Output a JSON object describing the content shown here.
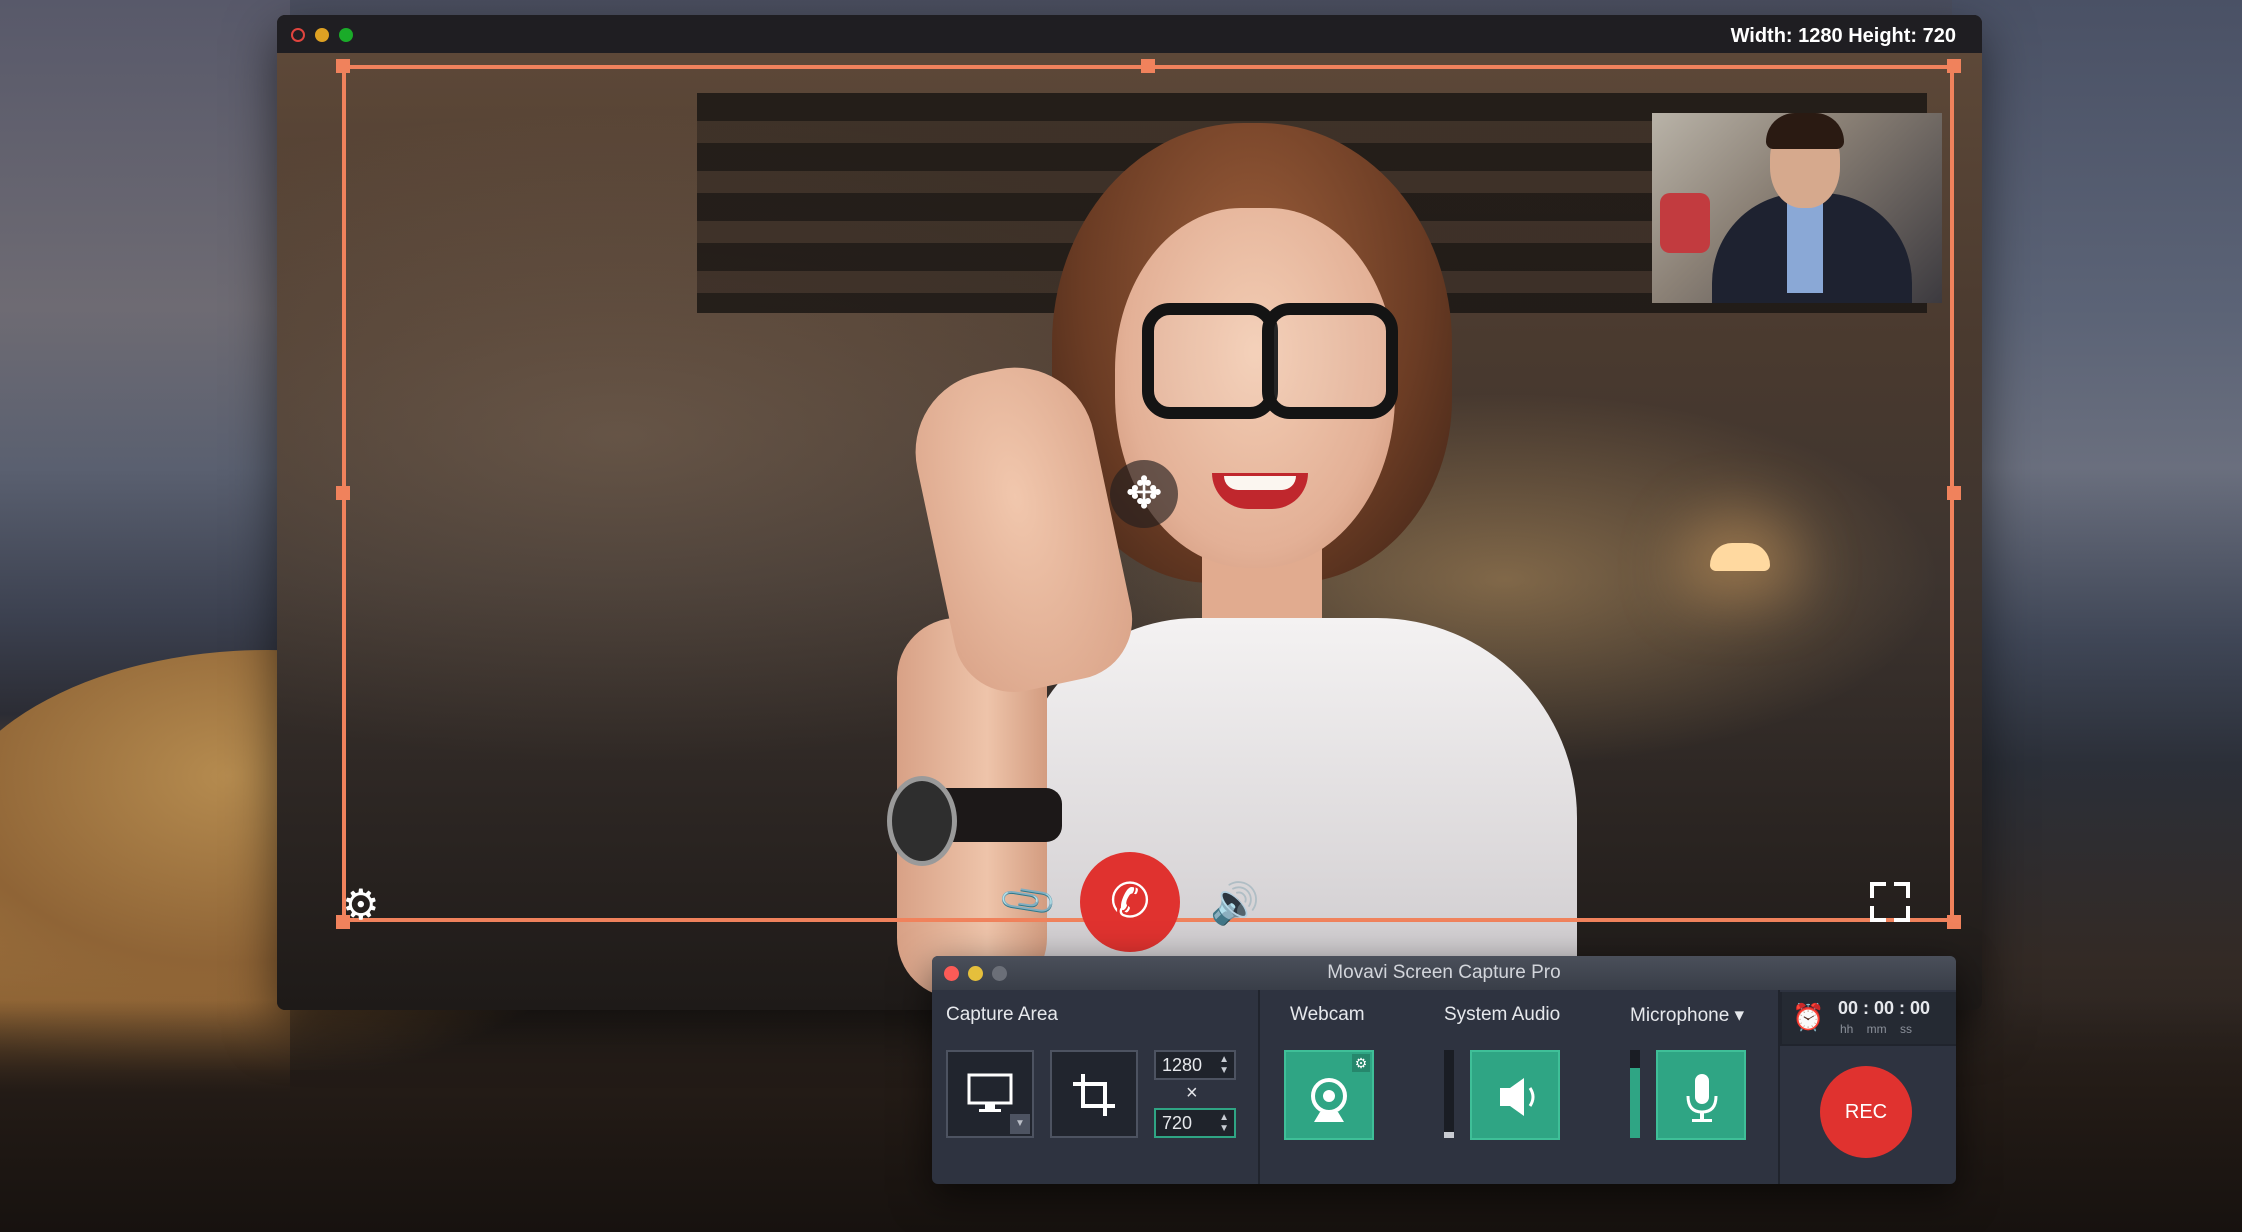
{
  "call_window": {
    "dimensions_label": "Width: 1280  Height: 720",
    "traffic_lights": [
      "#e0443e",
      "#dea123",
      "#1aab29"
    ]
  },
  "capture_frame": {
    "color": "#f0825c",
    "move_icon": "move-arrows-icon"
  },
  "call_controls": {
    "gear_icon": "gear-icon",
    "attach_icon": "paperclip-icon",
    "hangup_icon": "phone-icon",
    "speaker_icon": "speaker-icon",
    "fullscreen_icon": "fullscreen-icon",
    "hangup_color": "#e0322f"
  },
  "panel": {
    "title": "Movavi Screen Capture Pro",
    "traffic_lights": [
      "#fc5b57",
      "#e5bf3c",
      "#6b6f78"
    ],
    "capture_area": {
      "label": "Capture Area",
      "width": "1280",
      "height": "720",
      "times": "×"
    },
    "webcam": {
      "label": "Webcam"
    },
    "system_audio": {
      "label": "System Audio"
    },
    "microphone": {
      "label": "Microphone ▾"
    },
    "timer": {
      "value": "00 : 00 : 00",
      "units": "hh    mm    ss"
    },
    "rec_label": "REC",
    "accent": "#2fa584"
  }
}
